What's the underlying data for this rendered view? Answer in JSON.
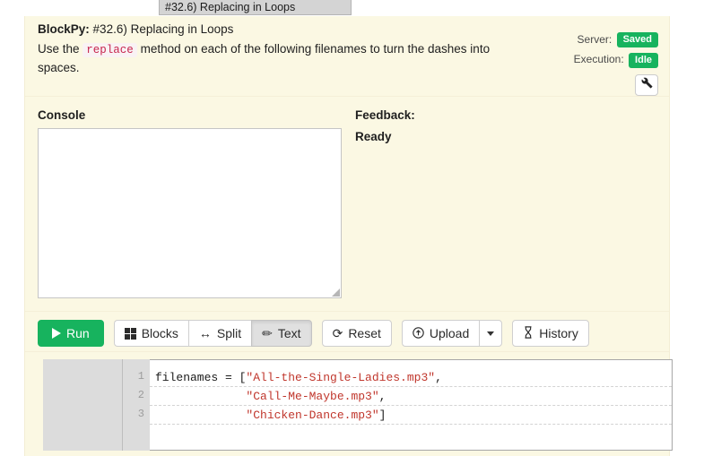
{
  "browser": {
    "tab_title": "#32.6) Replacing in Loops"
  },
  "instructions": {
    "app_name": "BlockPy:",
    "assignment_title": "#32.6) Replacing in Loops",
    "body_before": "Use the",
    "inline_code": "replace",
    "body_after": "method on each of the following filenames to turn the dashes into spaces."
  },
  "status": {
    "server_label": "Server:",
    "server_value": "Saved",
    "execution_label": "Execution:",
    "execution_value": "Idle",
    "settings_icon": "wrench-icon",
    "badge_color": "#17b35e"
  },
  "console": {
    "title": "Console",
    "content": ""
  },
  "feedback": {
    "title": "Feedback:",
    "status": "Ready"
  },
  "toolbar": {
    "run_label": "Run",
    "blocks_label": "Blocks",
    "split_label": "Split",
    "text_label": "Text",
    "reset_label": "Reset",
    "upload_label": "Upload",
    "history_label": "History",
    "active_view": "Text",
    "icons": {
      "run": "play-icon",
      "blocks": "grid-icon",
      "split": "arrows-horizontal-icon",
      "text": "pencil-icon",
      "reset": "refresh-icon",
      "upload": "upload-circle-icon",
      "upload_caret": "chevron-down-icon",
      "history": "hourglass-icon"
    },
    "icon_glyphs": {
      "split": "↔",
      "text": "✏",
      "reset": "⟳",
      "upload": "⍐",
      "history": "⧗"
    }
  },
  "editor": {
    "language": "python",
    "line_numbers": [
      "1",
      "2",
      "3"
    ],
    "lines": [
      [
        {
          "t": "filenames = [",
          "c": "plain"
        },
        {
          "t": "\"All-the-Single-Ladies.mp3\"",
          "c": "str"
        },
        {
          "t": ",",
          "c": "plain"
        }
      ],
      [
        {
          "t": "             ",
          "c": "plain"
        },
        {
          "t": "\"Call-Me-Maybe.mp3\"",
          "c": "str"
        },
        {
          "t": ",",
          "c": "plain"
        }
      ],
      [
        {
          "t": "             ",
          "c": "plain"
        },
        {
          "t": "\"Chicken-Dance.mp3\"",
          "c": "str"
        },
        {
          "t": "]",
          "c": "plain"
        }
      ]
    ]
  }
}
